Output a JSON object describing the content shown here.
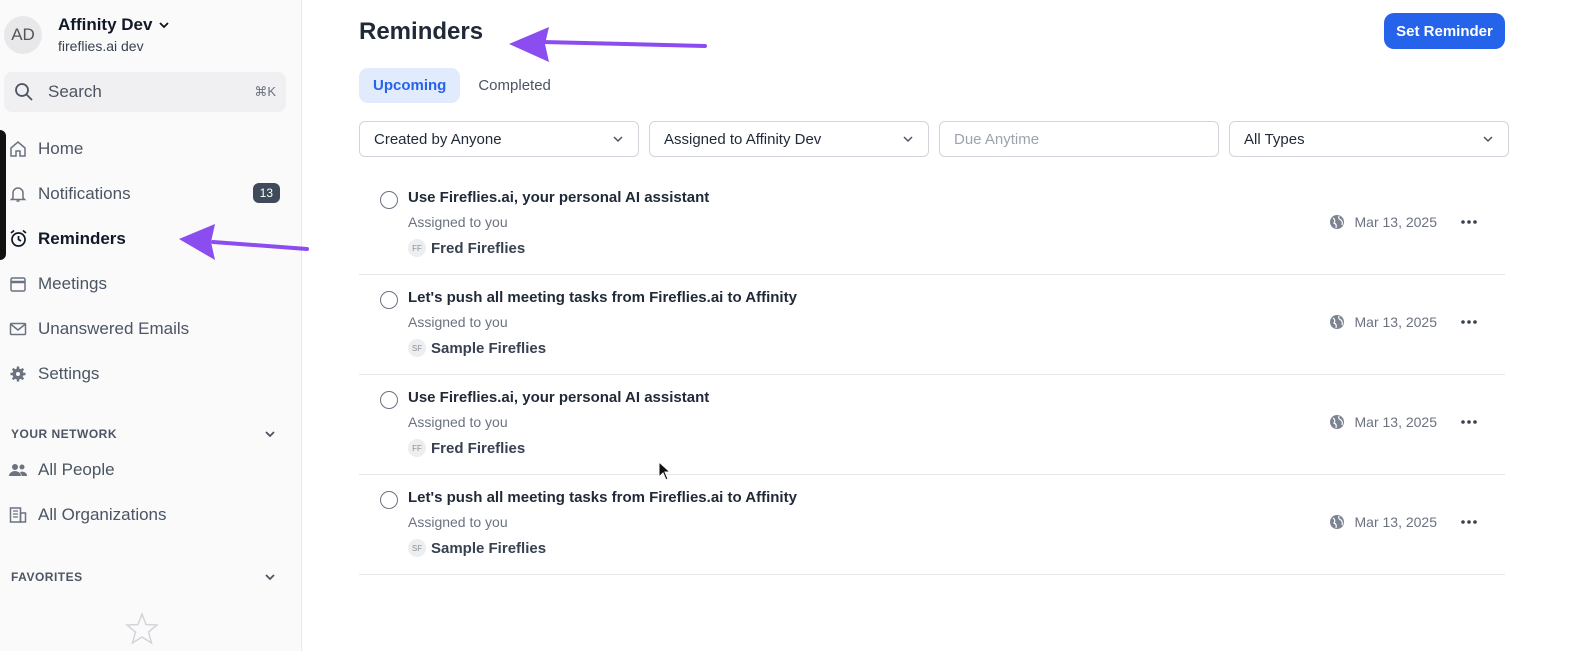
{
  "workspace": {
    "initials": "AD",
    "name": "Affinity Dev",
    "subtitle": "fireflies.ai dev"
  },
  "search": {
    "label": "Search",
    "shortcut": "⌘K"
  },
  "nav": [
    {
      "label": "Home",
      "icon": "home-icon"
    },
    {
      "label": "Notifications",
      "icon": "bell-icon",
      "badge": "13"
    },
    {
      "label": "Reminders",
      "icon": "alarm-clock-icon",
      "active": true
    },
    {
      "label": "Meetings",
      "icon": "calendar-icon"
    },
    {
      "label": "Unanswered Emails",
      "icon": "mail-icon"
    },
    {
      "label": "Settings",
      "icon": "gear-icon"
    }
  ],
  "network": {
    "heading": "YOUR NETWORK",
    "items": [
      {
        "label": "All People"
      },
      {
        "label": "All Organizations"
      }
    ]
  },
  "favorites": {
    "heading": "FAVORITES"
  },
  "main": {
    "title": "Reminders",
    "set_reminder": "Set Reminder",
    "tabs": [
      {
        "label": "Upcoming",
        "active": true
      },
      {
        "label": "Completed"
      }
    ],
    "filters": [
      {
        "value": "Created by Anyone"
      },
      {
        "value": "Assigned to Affinity Dev"
      },
      {
        "placeholder": "Due Anytime"
      },
      {
        "value": "All Types"
      }
    ],
    "reminders": [
      {
        "title": "Use Fireflies.ai, your personal AI assistant",
        "assigned": "Assigned to you",
        "owner_initials": "FF",
        "owner": "Fred Fireflies",
        "date": "Mar 13, 2025"
      },
      {
        "title": "Let's push all meeting tasks from Fireflies.ai to Affinity",
        "assigned": "Assigned to you",
        "owner_initials": "SF",
        "owner": "Sample Fireflies",
        "date": "Mar 13, 2025"
      },
      {
        "title": "Use Fireflies.ai, your personal AI assistant",
        "assigned": "Assigned to you",
        "owner_initials": "FF",
        "owner": "Fred Fireflies",
        "date": "Mar 13, 2025"
      },
      {
        "title": "Let's push all meeting tasks from Fireflies.ai to Affinity",
        "assigned": "Assigned to you",
        "owner_initials": "SF",
        "owner": "Sample Fireflies",
        "date": "Mar 13, 2025"
      }
    ]
  },
  "colors": {
    "accent": "#2563eb",
    "annotation_arrow": "#8b4cf0"
  }
}
